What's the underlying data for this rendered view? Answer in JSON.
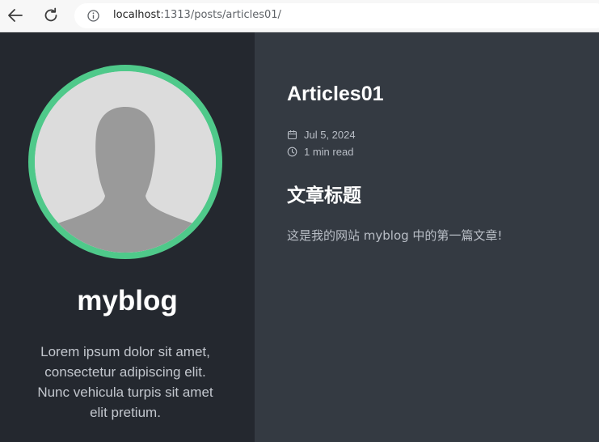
{
  "browser": {
    "url_host": "localhost",
    "url_rest": ":1313/posts/articles01/"
  },
  "icons": {
    "back": "back-arrow-icon",
    "reload": "reload-icon",
    "site_info": "info-icon",
    "calendar": "calendar-icon",
    "clock": "clock-icon"
  },
  "colors": {
    "sidebar_bg": "#24282f",
    "main_bg": "#343a42",
    "avatar_ring": "#4fc98a"
  },
  "sidebar": {
    "blog_name": "myblog",
    "description": "Lorem ipsum dolor sit amet, consectetur adipiscing elit. Nunc vehicula turpis sit amet elit pretium."
  },
  "post": {
    "title": "Articles01",
    "date": "Jul 5, 2024",
    "reading_time": "1 min read",
    "heading": "文章标题",
    "body": "这是我的网站 myblog 中的第一篇文章!"
  }
}
